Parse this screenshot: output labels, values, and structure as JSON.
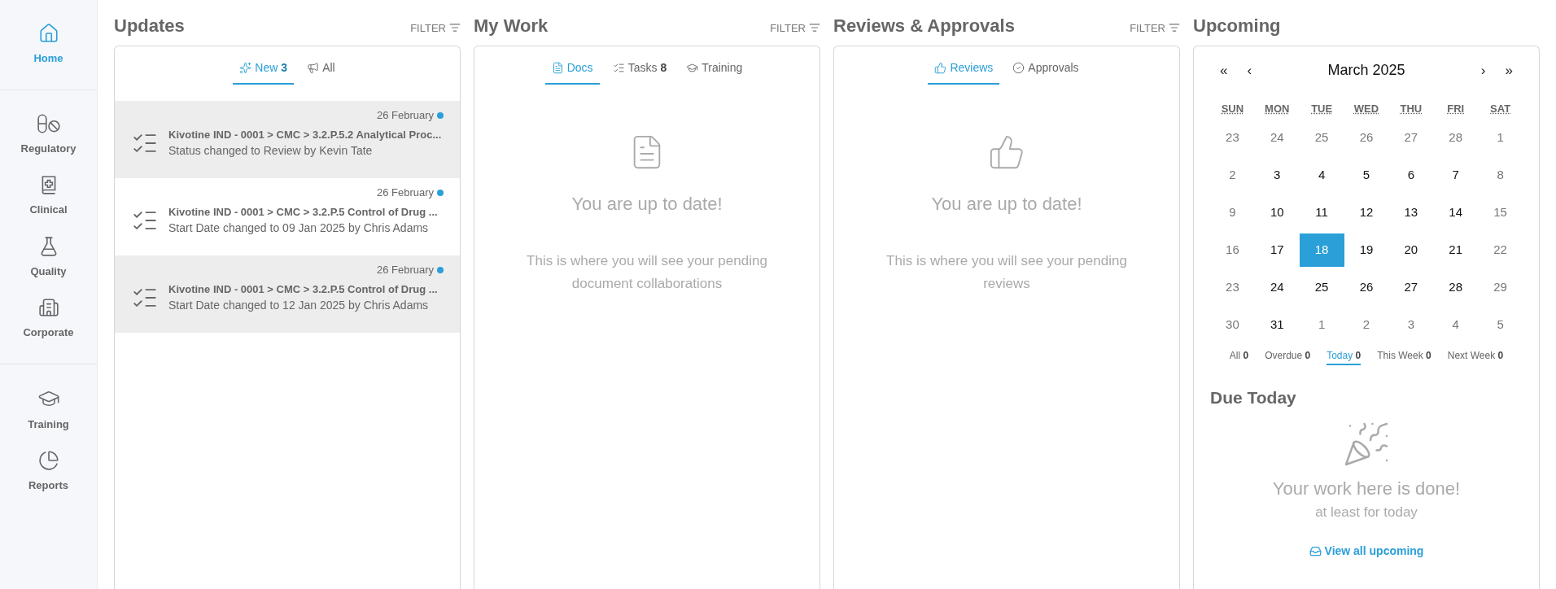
{
  "sidebar": {
    "sections": [
      [
        {
          "label": "Home",
          "kind": "home",
          "selected": true
        }
      ],
      [
        {
          "label": "Regulatory",
          "kind": "regulatory",
          "selected": false
        },
        {
          "label": "Clinical",
          "kind": "clinical",
          "selected": false
        },
        {
          "label": "Quality",
          "kind": "quality",
          "selected": false
        },
        {
          "label": "Corporate",
          "kind": "corporate",
          "selected": false
        }
      ],
      [
        {
          "label": "Training",
          "kind": "training",
          "selected": false
        },
        {
          "label": "Reports",
          "kind": "reports",
          "selected": false
        }
      ]
    ]
  },
  "updates": {
    "title": "Updates",
    "filter": "FILTER",
    "tabs": [
      {
        "label": "New",
        "count": "3",
        "kind": "sparkles",
        "selected": true
      },
      {
        "label": "All",
        "kind": "megaphone",
        "selected": false
      }
    ],
    "items": [
      {
        "date": "26 February",
        "unread": true,
        "path": "Kivotine IND - 0001 > CMC > 3.2.P.5.2 Analytical Proc...",
        "detail": "Status changed to Review by Kevin Tate"
      },
      {
        "date": "26 February",
        "unread": true,
        "path": "Kivotine IND - 0001 > CMC > 3.2.P.5 Control of Drug ...",
        "detail": "Start Date changed to 09 Jan 2025 by Chris Adams"
      },
      {
        "date": "26 February",
        "unread": true,
        "path": "Kivotine IND - 0001 > CMC > 3.2.P.5 Control of Drug ...",
        "detail": "Start Date changed to 12 Jan 2025 by Chris Adams"
      }
    ]
  },
  "my_work": {
    "title": "My Work",
    "filter": "FILTER",
    "tabs": [
      {
        "label": "Docs",
        "kind": "doc",
        "selected": true
      },
      {
        "label": "Tasks",
        "count": "8",
        "kind": "tasks",
        "selected": false
      },
      {
        "label": "Training",
        "kind": "training",
        "selected": false
      }
    ],
    "empty": {
      "kind": "doc",
      "heading": "You are up to date!",
      "message": "This is where you will see your pending document collaborations"
    }
  },
  "reviews": {
    "title": "Reviews & Approvals",
    "filter": "FILTER",
    "tabs": [
      {
        "label": "Reviews",
        "kind": "thumb",
        "selected": true
      },
      {
        "label": "Approvals",
        "kind": "check",
        "selected": false
      }
    ],
    "empty": {
      "kind": "thumb",
      "heading": "You are up to date!",
      "message": "This is where you will see your pending reviews"
    }
  },
  "upcoming": {
    "title": "Upcoming",
    "calendar": {
      "month": "March 2025",
      "nav": [
        "«",
        "‹",
        "›",
        "»"
      ],
      "weekdays": [
        "SUN",
        "MON",
        "TUE",
        "WED",
        "THU",
        "FRI",
        "SAT"
      ],
      "weeks": [
        [
          {
            "day": "23",
            "muted": true,
            "selected": false
          },
          {
            "day": "24",
            "muted": true,
            "selected": false
          },
          {
            "day": "25",
            "muted": true,
            "selected": false
          },
          {
            "day": "26",
            "muted": true,
            "selected": false
          },
          {
            "day": "27",
            "muted": true,
            "selected": false
          },
          {
            "day": "28",
            "muted": true,
            "selected": false
          },
          {
            "day": "1",
            "muted": true,
            "selected": false
          }
        ],
        [
          {
            "day": "2",
            "muted": true,
            "selected": false
          },
          {
            "day": "3",
            "muted": false,
            "selected": false
          },
          {
            "day": "4",
            "muted": false,
            "selected": false
          },
          {
            "day": "5",
            "muted": false,
            "selected": false
          },
          {
            "day": "6",
            "muted": false,
            "selected": false
          },
          {
            "day": "7",
            "muted": false,
            "selected": false
          },
          {
            "day": "8",
            "muted": true,
            "selected": false
          }
        ],
        [
          {
            "day": "9",
            "muted": true,
            "selected": false
          },
          {
            "day": "10",
            "muted": false,
            "selected": false
          },
          {
            "day": "11",
            "muted": false,
            "selected": false
          },
          {
            "day": "12",
            "muted": false,
            "selected": false
          },
          {
            "day": "13",
            "muted": false,
            "selected": false
          },
          {
            "day": "14",
            "muted": false,
            "selected": false
          },
          {
            "day": "15",
            "muted": true,
            "selected": false
          }
        ],
        [
          {
            "day": "16",
            "muted": true,
            "selected": false
          },
          {
            "day": "17",
            "muted": false,
            "selected": false
          },
          {
            "day": "18",
            "muted": false,
            "selected": true
          },
          {
            "day": "19",
            "muted": false,
            "selected": false
          },
          {
            "day": "20",
            "muted": false,
            "selected": false
          },
          {
            "day": "21",
            "muted": false,
            "selected": false
          },
          {
            "day": "22",
            "muted": true,
            "selected": false
          }
        ],
        [
          {
            "day": "23",
            "muted": true,
            "selected": false
          },
          {
            "day": "24",
            "muted": false,
            "selected": false
          },
          {
            "day": "25",
            "muted": false,
            "selected": false
          },
          {
            "day": "26",
            "muted": false,
            "selected": false
          },
          {
            "day": "27",
            "muted": false,
            "selected": false
          },
          {
            "day": "28",
            "muted": false,
            "selected": false
          },
          {
            "day": "29",
            "muted": true,
            "selected": false
          }
        ],
        [
          {
            "day": "30",
            "muted": true,
            "selected": false
          },
          {
            "day": "31",
            "muted": false,
            "selected": false
          },
          {
            "day": "1",
            "muted": true,
            "selected": false
          },
          {
            "day": "2",
            "muted": true,
            "selected": false
          },
          {
            "day": "3",
            "muted": true,
            "selected": false
          },
          {
            "day": "4",
            "muted": true,
            "selected": false
          },
          {
            "day": "5",
            "muted": true,
            "selected": false
          }
        ]
      ]
    },
    "filters": [
      {
        "label": "All",
        "count": "0",
        "selected": false
      },
      {
        "label": "Overdue",
        "count": "0",
        "selected": false
      },
      {
        "label": "Today",
        "count": "0",
        "selected": true
      },
      {
        "label": "This Week",
        "count": "0",
        "selected": false
      },
      {
        "label": "Next Week",
        "count": "0",
        "selected": false
      }
    ],
    "due": {
      "title": "Due Today",
      "heading": "Your work here is done!",
      "subheading": "at least for today",
      "link": "View all upcoming"
    }
  }
}
